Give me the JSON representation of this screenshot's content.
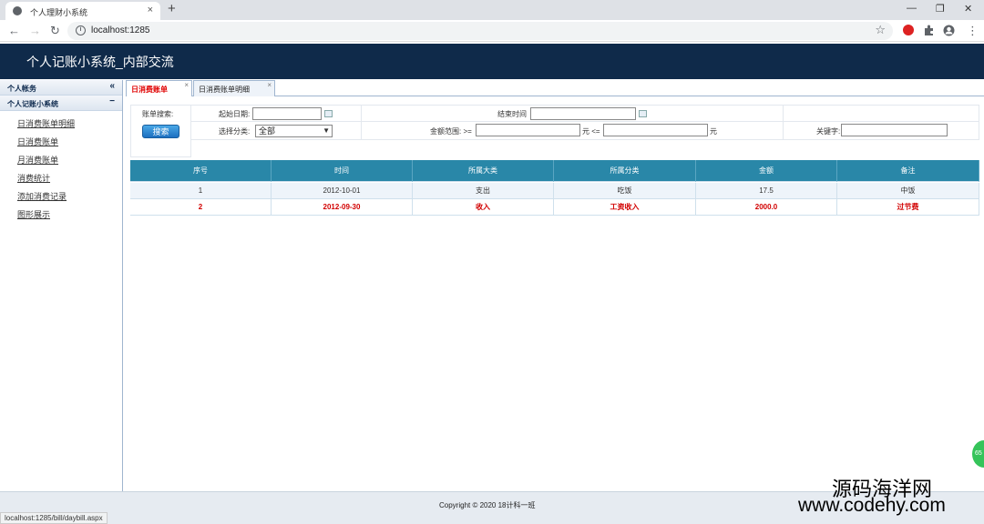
{
  "browser": {
    "tab_title": "个人理财小系统",
    "tab_close": "×",
    "new_tab": "+",
    "url": "localhost:1285",
    "minimize": "—",
    "maximize": "❐",
    "close": "✕",
    "back": "←",
    "forward": "→",
    "reload": "↻",
    "star": "☆",
    "menu": "⋮"
  },
  "app": {
    "title": "个人记账小系统_内部交流"
  },
  "sidebar": {
    "section1": {
      "label": "个人帐务",
      "ctl": "«"
    },
    "section2": {
      "label": "个人记账小系统",
      "ctl": "−"
    },
    "items": [
      "日消费账单明细",
      "日消费账单",
      "月消费账单",
      "消费统计",
      "添加消费记录",
      "图形展示"
    ]
  },
  "tabs": [
    {
      "label": "日消费账单",
      "color": "#e00000",
      "close": "×"
    },
    {
      "label": "日消费账单明细",
      "color": "#222222",
      "close": "×"
    }
  ],
  "search": {
    "title": "账单搜索:",
    "button": "搜索",
    "start_label": "起始日期:",
    "end_label": "结束时间",
    "category_label": "选择分类:",
    "category_value": "全部",
    "amount_label": "金额范围: >=",
    "amount_unit1": "元 <=",
    "amount_unit2": "元",
    "keyword_label": "关键字:"
  },
  "table": {
    "headers": [
      "序号",
      "时间",
      "所属大类",
      "所属分类",
      "金额",
      "备注"
    ],
    "rows": [
      [
        "1",
        "2012-10-01",
        "支出",
        "吃饭",
        "17.5",
        "中饭"
      ],
      [
        "2",
        "2012-09-30",
        "收入",
        "工资收入",
        "2000.0",
        "过节费"
      ]
    ]
  },
  "footer": {
    "copyright": "Copyright © 2020 18计科一班"
  },
  "status_url": "localhost:1285/bill/daybill.aspx",
  "watermark": {
    "line1": "源码海洋网",
    "line2": "www.codehy.com"
  },
  "badge": "65",
  "colors": {
    "header_bg": "#0f2a4a",
    "table_head": "#2987a8",
    "highlight_row": "#d20000",
    "button": "#1c6fc0"
  }
}
